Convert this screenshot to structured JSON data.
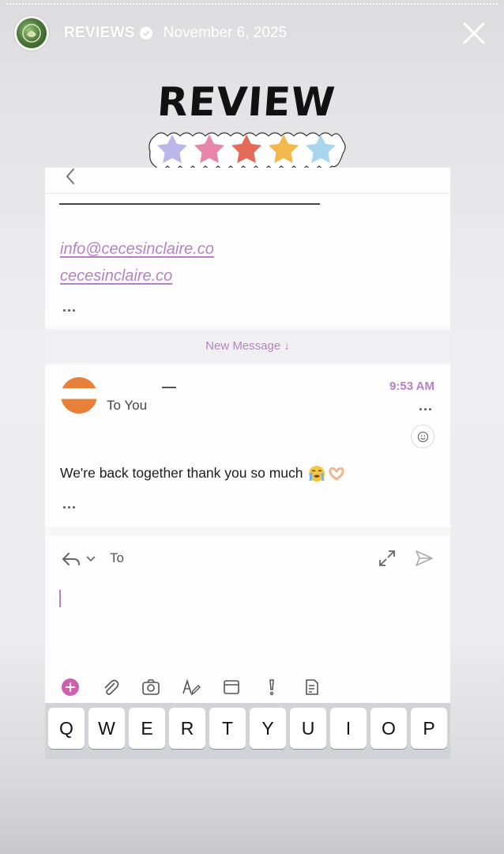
{
  "story": {
    "account_name": "REVIEWS",
    "date": "November 6, 2025",
    "sticker_title": "REVIEW",
    "rating_stars": 5
  },
  "email": {
    "links": [
      "info@cecesinclaire.co",
      "cecesinclaire.co"
    ],
    "more": "...",
    "new_message_label": "New Message ↓",
    "message": {
      "recipient": "To You",
      "time": "9:53 AM",
      "body": "We're back together thank you so much",
      "more": "..."
    },
    "compose": {
      "to_label": "To"
    }
  },
  "keyboard": {
    "keys": [
      "Q",
      "W",
      "E",
      "R",
      "T",
      "Y",
      "U",
      "I",
      "O",
      "P"
    ]
  },
  "colors": {
    "accent": "#b482c4",
    "star_colors": [
      "#b9b8e8",
      "#e786a8",
      "#e46a5a",
      "#f2b84b",
      "#a9d6ef"
    ]
  }
}
